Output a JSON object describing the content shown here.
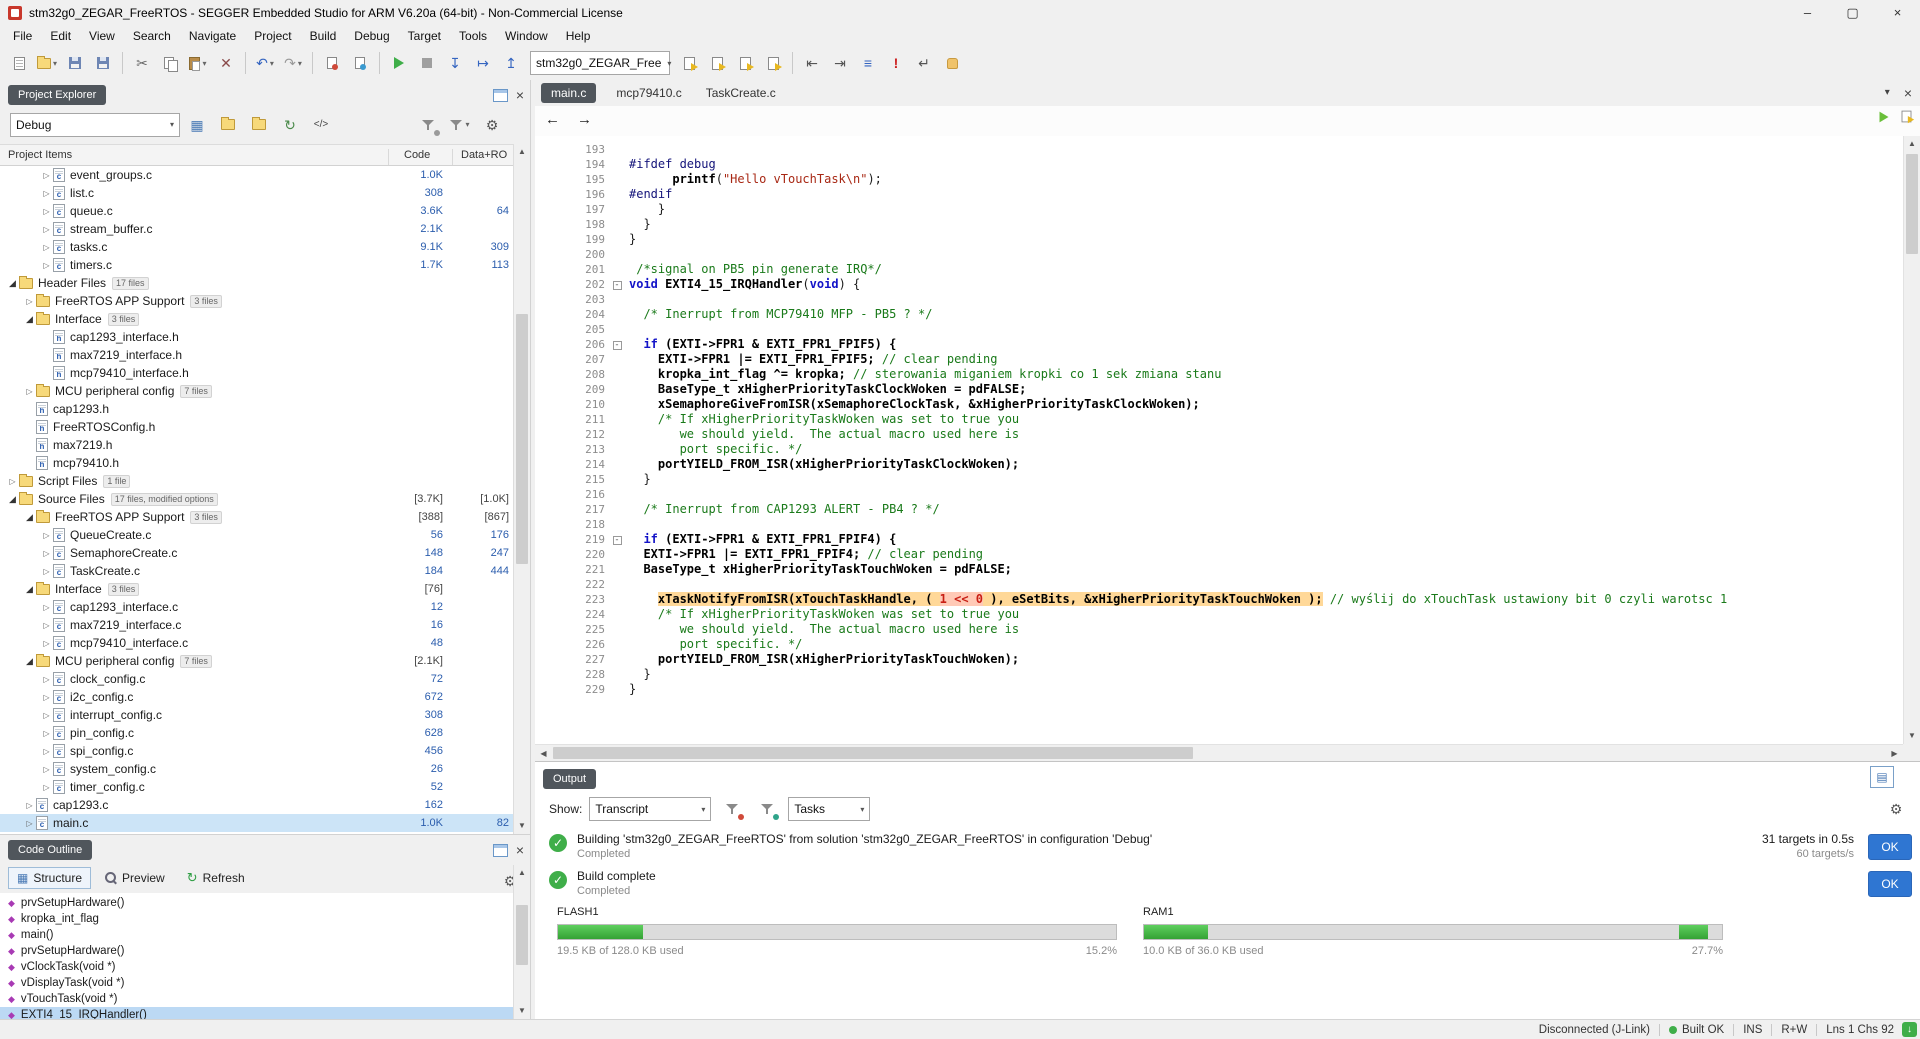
{
  "window": {
    "title": "stm32g0_ZEGAR_FreeRTOS - SEGGER Embedded Studio for ARM V6.20a (64-bit) - Non-Commercial License",
    "controls": {
      "minimize": "–",
      "maximize": "▢",
      "close": "×"
    }
  },
  "menu": [
    "File",
    "Edit",
    "View",
    "Search",
    "Navigate",
    "Project",
    "Build",
    "Debug",
    "Target",
    "Tools",
    "Window",
    "Help"
  ],
  "toolbar": {
    "target_selector": "stm32g0_ZEGAR_Free",
    "items": [
      {
        "n": "new-file-icon",
        "k": "page"
      },
      {
        "n": "open-file-icon",
        "k": "folder",
        "arr": true
      },
      {
        "n": "save-icon",
        "k": "floppy"
      },
      {
        "n": "save-all-icon",
        "k": "floppy floppy2"
      },
      {
        "n": "sep"
      },
      {
        "n": "cut-icon",
        "g": "✂",
        "c": "#666666"
      },
      {
        "n": "copy-icon",
        "k": "copy"
      },
      {
        "n": "paste-icon",
        "k": "paste",
        "arr": true
      },
      {
        "n": "delete-icon",
        "g": "✕",
        "c": "#8a4a4a"
      },
      {
        "n": "sep"
      },
      {
        "n": "undo-icon",
        "g": "↶",
        "c": "#3565c0",
        "arr": true
      },
      {
        "n": "redo-icon",
        "g": "↷",
        "c": "#9a9a9a",
        "arr": true
      },
      {
        "n": "sep"
      },
      {
        "n": "toggle-bookmark-icon",
        "k": "bm r"
      },
      {
        "n": "clear-bookmarks-icon",
        "k": "bm b"
      },
      {
        "n": "sep"
      },
      {
        "n": "run-icon",
        "k": "play"
      },
      {
        "n": "stop-icon",
        "k": "stop"
      },
      {
        "n": "step-into-icon",
        "g": "↧",
        "c": "#3565c0"
      },
      {
        "n": "step-over-icon",
        "g": "↦",
        "c": "#3565c0"
      },
      {
        "n": "step-out-icon",
        "g": "↥",
        "c": "#3565c0"
      },
      {
        "n": "combo"
      },
      {
        "n": "compile-file-icon",
        "k": "build"
      },
      {
        "n": "build-project-icon",
        "k": "build"
      },
      {
        "n": "rebuild-project-icon",
        "k": "build"
      },
      {
        "n": "cancel-build-icon",
        "k": "build"
      },
      {
        "n": "sep"
      },
      {
        "n": "outdent-icon",
        "g": "⇤",
        "c": "#555555"
      },
      {
        "n": "indent-icon",
        "g": "⇥",
        "c": "#555555"
      },
      {
        "n": "comment-icon",
        "g": "≡",
        "c": "#3565c0"
      },
      {
        "n": "next-error-icon",
        "g": "!",
        "c": "#cc2222"
      },
      {
        "n": "goto-line-icon",
        "g": "↵",
        "c": "#555555"
      },
      {
        "n": "pan-hand-icon",
        "k": "hand"
      }
    ]
  },
  "project_explorer": {
    "title": "Project Explorer",
    "config": "Debug",
    "columns": {
      "items": "Project Items",
      "code": "Code",
      "data": "Data+RO"
    },
    "rows": [
      {
        "label": "event_groups.c",
        "indent": 3,
        "arrow": "right",
        "icon": "c",
        "code": "1.0K",
        "data": ""
      },
      {
        "label": "list.c",
        "indent": 3,
        "arrow": "right",
        "icon": "c",
        "code": "308",
        "data": ""
      },
      {
        "label": "queue.c",
        "indent": 3,
        "arrow": "right",
        "icon": "c",
        "code": "3.6K",
        "data": "64"
      },
      {
        "label": "stream_buffer.c",
        "indent": 3,
        "arrow": "right",
        "icon": "c",
        "code": "2.1K",
        "data": ""
      },
      {
        "label": "tasks.c",
        "indent": 3,
        "arrow": "right",
        "icon": "c",
        "code": "9.1K",
        "data": "309"
      },
      {
        "label": "timers.c",
        "indent": 3,
        "arrow": "right",
        "icon": "c",
        "code": "1.7K",
        "data": "113"
      },
      {
        "label": "Header Files",
        "badge": "17 files",
        "indent": 1,
        "arrow": "down",
        "icon": "folder",
        "code": "",
        "data": ""
      },
      {
        "label": "FreeRTOS APP Support",
        "badge": "3 files",
        "indent": 2,
        "arrow": "right",
        "icon": "folder",
        "code": "",
        "data": ""
      },
      {
        "label": "Interface",
        "badge": "3 files",
        "indent": 2,
        "arrow": "down",
        "icon": "folder",
        "code": "",
        "data": ""
      },
      {
        "label": "cap1293_interface.h",
        "indent": 3,
        "arrow": "",
        "icon": "h",
        "code": "",
        "data": ""
      },
      {
        "label": "max7219_interface.h",
        "indent": 3,
        "arrow": "",
        "icon": "h",
        "code": "",
        "data": ""
      },
      {
        "label": "mcp79410_interface.h",
        "indent": 3,
        "arrow": "",
        "icon": "h",
        "code": "",
        "data": ""
      },
      {
        "label": "MCU peripheral config",
        "badge": "7 files",
        "indent": 2,
        "arrow": "right",
        "icon": "folder",
        "code": "",
        "data": ""
      },
      {
        "label": "cap1293.h",
        "indent": 2,
        "arrow": "",
        "icon": "h",
        "code": "",
        "data": ""
      },
      {
        "label": "FreeRTOSConfig.h",
        "indent": 2,
        "arrow": "",
        "icon": "h",
        "code": "",
        "data": ""
      },
      {
        "label": "max7219.h",
        "indent": 2,
        "arrow": "",
        "icon": "h",
        "code": "",
        "data": ""
      },
      {
        "label": "mcp79410.h",
        "indent": 2,
        "arrow": "",
        "icon": "h",
        "code": "",
        "data": ""
      },
      {
        "label": "Script Files",
        "badge": "1 file",
        "indent": 1,
        "arrow": "right",
        "icon": "folder",
        "code": "",
        "data": ""
      },
      {
        "label": "Source Files",
        "badge": "17 files, modified options",
        "indent": 1,
        "arrow": "down",
        "icon": "folder",
        "code": "[3.7K]",
        "data": "[1.0K]"
      },
      {
        "label": "FreeRTOS APP Support",
        "badge": "3 files",
        "indent": 2,
        "arrow": "down",
        "icon": "folder",
        "code": "[388]",
        "data": "[867]"
      },
      {
        "label": "QueueCreate.c",
        "indent": 3,
        "arrow": "right",
        "icon": "c",
        "code": "56",
        "data": "176"
      },
      {
        "label": "SemaphoreCreate.c",
        "indent": 3,
        "arrow": "right",
        "icon": "c",
        "code": "148",
        "data": "247"
      },
      {
        "label": "TaskCreate.c",
        "indent": 3,
        "arrow": "right",
        "icon": "c",
        "code": "184",
        "data": "444"
      },
      {
        "label": "Interface",
        "badge": "3 files",
        "indent": 2,
        "arrow": "down",
        "icon": "folder",
        "code": "[76]",
        "data": ""
      },
      {
        "label": "cap1293_interface.c",
        "indent": 3,
        "arrow": "right",
        "icon": "c",
        "code": "12",
        "data": ""
      },
      {
        "label": "max7219_interface.c",
        "indent": 3,
        "arrow": "right",
        "icon": "c",
        "code": "16",
        "data": ""
      },
      {
        "label": "mcp79410_interface.c",
        "indent": 3,
        "arrow": "right",
        "icon": "c",
        "code": "48",
        "data": ""
      },
      {
        "label": "MCU peripheral config",
        "badge": "7 files",
        "indent": 2,
        "arrow": "down",
        "icon": "folder",
        "code": "[2.1K]",
        "data": ""
      },
      {
        "label": "clock_config.c",
        "indent": 3,
        "arrow": "right",
        "icon": "c",
        "code": "72",
        "data": ""
      },
      {
        "label": "i2c_config.c",
        "indent": 3,
        "arrow": "right",
        "icon": "c",
        "code": "672",
        "data": ""
      },
      {
        "label": "interrupt_config.c",
        "indent": 3,
        "arrow": "right",
        "icon": "c",
        "code": "308",
        "data": ""
      },
      {
        "label": "pin_config.c",
        "indent": 3,
        "arrow": "right",
        "icon": "c",
        "code": "628",
        "data": ""
      },
      {
        "label": "spi_config.c",
        "indent": 3,
        "arrow": "right",
        "icon": "c",
        "code": "456",
        "data": ""
      },
      {
        "label": "system_config.c",
        "indent": 3,
        "arrow": "right",
        "icon": "c",
        "code": "26",
        "data": ""
      },
      {
        "label": "timer_config.c",
        "indent": 3,
        "arrow": "right",
        "icon": "c",
        "code": "52",
        "data": ""
      },
      {
        "label": "cap1293.c",
        "indent": 2,
        "arrow": "right",
        "icon": "c",
        "code": "162",
        "data": ""
      },
      {
        "label": "main.c",
        "indent": 2,
        "arrow": "right",
        "icon": "c",
        "code": "1.0K",
        "data": "82",
        "selected": true
      }
    ]
  },
  "editor": {
    "tabs": [
      {
        "label": "main.c",
        "active": true
      },
      {
        "label": "mcp79410.c"
      },
      {
        "label": "TaskCreate.c"
      }
    ],
    "lines": [
      {
        "n": 193,
        "s": []
      },
      {
        "n": 194,
        "s": [
          [
            "pp",
            "#ifdef debug"
          ]
        ]
      },
      {
        "n": 195,
        "s": [
          [
            "t",
            "      "
          ],
          [
            "b",
            "printf"
          ],
          [
            "t",
            "("
          ],
          [
            "s",
            "\"Hello vTouchTask\\n\""
          ],
          [
            "t",
            ");"
          ]
        ]
      },
      {
        "n": 196,
        "s": [
          [
            "pp",
            "#endif"
          ]
        ]
      },
      {
        "n": 197,
        "s": [
          [
            "t",
            "    }"
          ]
        ]
      },
      {
        "n": 198,
        "s": [
          [
            "t",
            "  }"
          ]
        ]
      },
      {
        "n": 199,
        "s": [
          [
            "t",
            "}"
          ]
        ]
      },
      {
        "n": 200,
        "s": []
      },
      {
        "n": 201,
        "s": [
          [
            "t",
            " "
          ],
          [
            "c",
            "/*signal on PB5 pin generate IRQ*/"
          ]
        ]
      },
      {
        "n": 202,
        "f": 1,
        "s": [
          [
            "k",
            "void"
          ],
          [
            "t",
            " "
          ],
          [
            "b",
            "EXTI4_15_IRQHandler"
          ],
          [
            "t",
            "("
          ],
          [
            "k",
            "void"
          ],
          [
            "t",
            ") {"
          ]
        ]
      },
      {
        "n": 203,
        "s": []
      },
      {
        "n": 204,
        "s": [
          [
            "t",
            "  "
          ],
          [
            "c",
            "/* Inerrupt from MCP79410 MFP - PB5 ? */"
          ]
        ]
      },
      {
        "n": 205,
        "s": []
      },
      {
        "n": 206,
        "f": 1,
        "s": [
          [
            "t",
            "  "
          ],
          [
            "k",
            "if"
          ],
          [
            "b",
            " (EXTI->FPR1 & EXTI_FPR1_FPIF5) {"
          ]
        ]
      },
      {
        "n": 207,
        "s": [
          [
            "b",
            "    EXTI->FPR1 |= EXTI_FPR1_FPIF5; "
          ],
          [
            "c",
            "// clear pending"
          ]
        ]
      },
      {
        "n": 208,
        "s": [
          [
            "b",
            "    kropka_int_flag ^= kropka; "
          ],
          [
            "c",
            "// sterowania miganiem kropki co 1 sek zmiana stanu"
          ]
        ]
      },
      {
        "n": 209,
        "s": [
          [
            "b",
            "    BaseType_t xHigherPriorityTaskClockWoken = pdFALSE;"
          ]
        ]
      },
      {
        "n": 210,
        "s": [
          [
            "b",
            "    xSemaphoreGiveFromISR(xSemaphoreClockTask, &xHigherPriorityTaskClockWoken);"
          ]
        ]
      },
      {
        "n": 211,
        "s": [
          [
            "t",
            "    "
          ],
          [
            "c",
            "/* If xHigherPriorityTaskWoken was set to true you"
          ]
        ]
      },
      {
        "n": 212,
        "s": [
          [
            "t",
            "       "
          ],
          [
            "c",
            "we should yield.  The actual macro used here is"
          ]
        ]
      },
      {
        "n": 213,
        "s": [
          [
            "t",
            "       "
          ],
          [
            "c",
            "port specific. */"
          ]
        ]
      },
      {
        "n": 214,
        "s": [
          [
            "b",
            "    portYIELD_FROM_ISR(xHigherPriorityTaskClockWoken);"
          ]
        ]
      },
      {
        "n": 215,
        "s": [
          [
            "t",
            "  }"
          ]
        ]
      },
      {
        "n": 216,
        "s": []
      },
      {
        "n": 217,
        "s": [
          [
            "t",
            "  "
          ],
          [
            "c",
            "/* Inerrupt from CAP1293 ALERT - PB4 ? */"
          ]
        ]
      },
      {
        "n": 218,
        "s": []
      },
      {
        "n": 219,
        "f": 1,
        "s": [
          [
            "t",
            "  "
          ],
          [
            "k",
            "if"
          ],
          [
            "b",
            " (EXTI->FPR1 & EXTI_FPR1_FPIF4) {"
          ]
        ]
      },
      {
        "n": 220,
        "s": [
          [
            "b",
            "  EXTI->FPR1 |= EXTI_FPR1_FPIF4; "
          ],
          [
            "c",
            "// clear pending"
          ]
        ]
      },
      {
        "n": 221,
        "s": [
          [
            "b",
            "  BaseType_t xHigherPriorityTaskTouchWoken = pdFALSE;"
          ]
        ]
      },
      {
        "n": 222,
        "s": []
      },
      {
        "n": 223,
        "s": [
          [
            "t",
            "    "
          ],
          [
            "hl",
            "xTaskNotifyFromISR(xTouchTaskHandle, ( "
          ],
          [
            "hn",
            "1 << 0"
          ],
          [
            "hl",
            " ), eSetBits, &xHigherPriorityTaskTouchWoken );"
          ],
          [
            "t",
            " "
          ],
          [
            "c",
            "// wyślij do xTouchTask ustawiony bit 0 czyli warotsc 1"
          ]
        ]
      },
      {
        "n": 224,
        "s": [
          [
            "t",
            "    "
          ],
          [
            "c",
            "/* If xHigherPriorityTaskWoken was set to true you"
          ]
        ]
      },
      {
        "n": 225,
        "s": [
          [
            "t",
            "       "
          ],
          [
            "c",
            "we should yield.  The actual macro used here is"
          ]
        ]
      },
      {
        "n": 226,
        "s": [
          [
            "t",
            "       "
          ],
          [
            "c",
            "port specific. */"
          ]
        ]
      },
      {
        "n": 227,
        "s": [
          [
            "b",
            "    portYIELD_FROM_ISR(xHigherPriorityTaskTouchWoken);"
          ]
        ]
      },
      {
        "n": 228,
        "s": [
          [
            "t",
            "  }"
          ]
        ]
      },
      {
        "n": 229,
        "s": [
          [
            "t",
            "}"
          ]
        ]
      }
    ]
  },
  "code_outline": {
    "title": "Code Outline",
    "tabs": [
      {
        "label": "Structure",
        "active": true
      },
      {
        "label": "Preview"
      },
      {
        "label": "Refresh"
      }
    ],
    "items": [
      {
        "label": "prvSetupHardware()"
      },
      {
        "label": "kropka_int_flag"
      },
      {
        "label": "main()"
      },
      {
        "label": "prvSetupHardware()"
      },
      {
        "label": "vClockTask(void *)"
      },
      {
        "label": "vDisplayTask(void *)"
      },
      {
        "label": "vTouchTask(void *)"
      },
      {
        "label": "EXTI4_15_IRQHandler()",
        "selected": true
      }
    ]
  },
  "output": {
    "title": "Output",
    "show_label": "Show:",
    "transcript": "Transcript",
    "tasks": "Tasks",
    "messages": [
      {
        "title": "Building 'stm32g0_ZEGAR_FreeRTOS' from solution 'stm32g0_ZEGAR_FreeRTOS' in configuration 'Debug'",
        "status": "Completed",
        "meta": "31 targets in 0.5s",
        "meta2": "60 targets/s",
        "button": "OK"
      },
      {
        "title": "Build complete",
        "status": "Completed",
        "meta": "",
        "meta2": "",
        "button": "OK"
      }
    ],
    "memory": [
      {
        "label": "FLASH1",
        "used": "19.5 KB of 128.0 KB used",
        "pct": "15.2%",
        "segments": [
          [
            0,
            15.2
          ]
        ]
      },
      {
        "label": "RAM1",
        "used": "10.0 KB of 36.0 KB used",
        "pct": "27.7%",
        "segments": [
          [
            0,
            11
          ],
          [
            92.5,
            97.5
          ]
        ]
      }
    ]
  },
  "status_bar": {
    "items": [
      {
        "label": "Disconnected (J-Link)"
      },
      {
        "label": "Built OK",
        "dot": "#3fae49"
      },
      {
        "label": "INS"
      },
      {
        "label": "R+W"
      },
      {
        "label": "Lns 1 Chs 92"
      }
    ]
  },
  "colors": {
    "selection": "#cce4f7",
    "ok_button": "#2f76d2",
    "progress_green": "#43b943",
    "code_highlight": "#ffd898",
    "panel_pill": "#50565c"
  }
}
